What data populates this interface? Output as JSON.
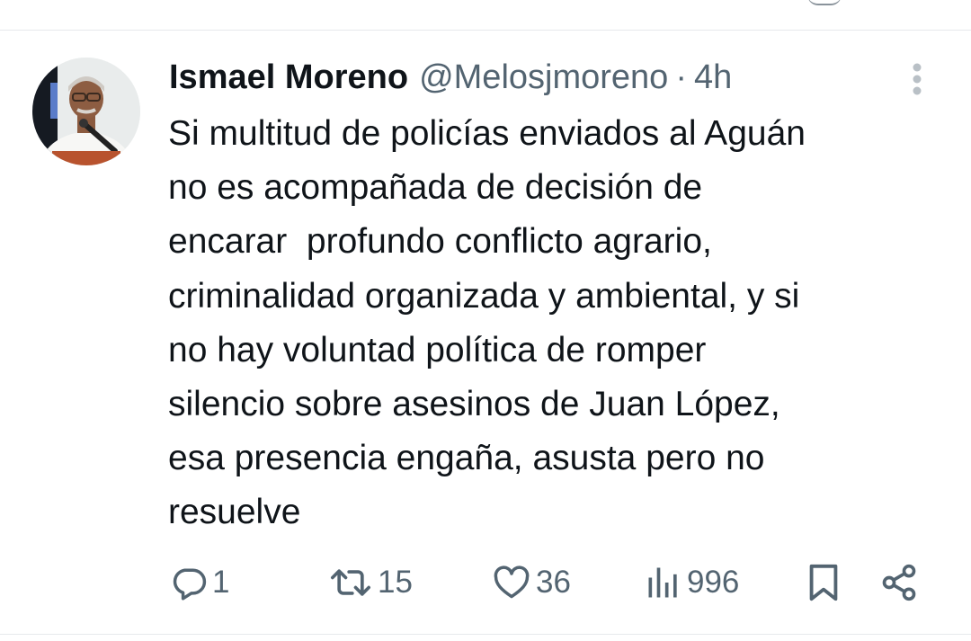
{
  "tweet": {
    "author": {
      "name": "Ismael Moreno",
      "handle": "@Melosjmoreno",
      "separator": "·",
      "time": "4h"
    },
    "text": "Si multitud de policías enviados al Aguán\nno es acompañada de decisión de\nencarar  profundo conflicto agrario,\ncriminalidad organizada y ambiental, y si\nno hay voluntad política de romper\nsilencio sobre asesinos de Juan López,\nesa presencia engaña, asusta pero no\nresuelve",
    "actions": {
      "replies": "1",
      "reposts": "15",
      "likes": "36",
      "views": "996"
    }
  },
  "icons": {
    "more": "more-vertical-icon",
    "reply": "reply-icon",
    "repost": "repost-icon",
    "like": "heart-icon",
    "views": "views-icon",
    "bookmark": "bookmark-icon",
    "share": "share-icon"
  },
  "colors": {
    "text": "#0f1419",
    "secondary": "#536471",
    "divider": "#e6e9ec"
  }
}
